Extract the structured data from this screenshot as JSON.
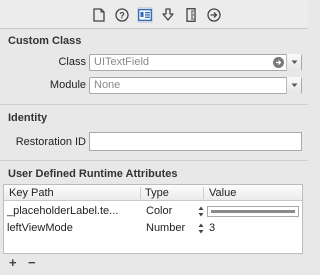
{
  "toolbar": {
    "icons": [
      "file-inspector-icon",
      "quick-help-icon",
      "identity-inspector-icon",
      "attributes-inspector-icon",
      "size-inspector-icon",
      "connections-inspector-icon"
    ],
    "selected": "identity-inspector-icon"
  },
  "custom_class": {
    "title": "Custom Class",
    "class_label": "Class",
    "class_value": "UITextField",
    "module_label": "Module",
    "module_value": "None"
  },
  "identity": {
    "title": "Identity",
    "restoration_label": "Restoration ID",
    "restoration_value": ""
  },
  "runtime_attributes": {
    "title": "User Defined Runtime Attributes",
    "columns": [
      "Key Path",
      "Type",
      "Value"
    ],
    "rows": [
      {
        "key_path": "_placeholderLabel.te...",
        "type": "Color",
        "value": ""
      },
      {
        "key_path": "leftViewMode",
        "type": "Number",
        "value": "3"
      }
    ],
    "add_label": "+",
    "remove_label": "−"
  }
}
